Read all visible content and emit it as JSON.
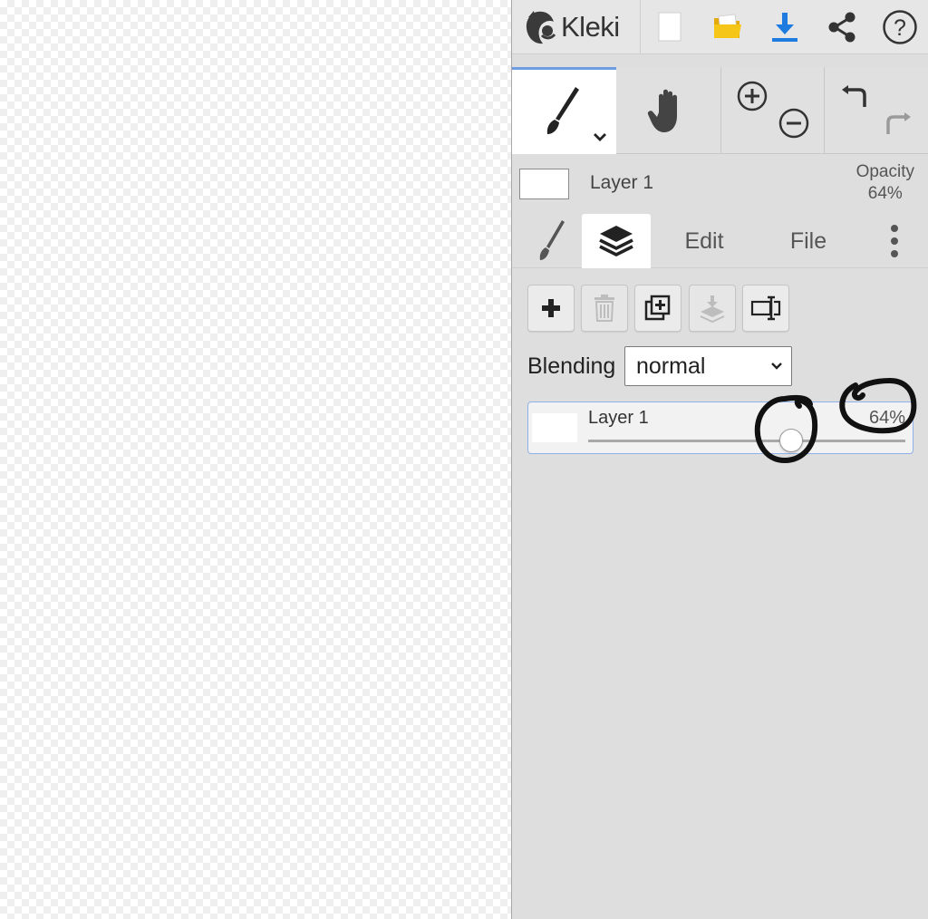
{
  "app": {
    "name": "Kleki"
  },
  "toolbar": {
    "icons": [
      "logo-icon",
      "new-image-icon",
      "open-folder-icon",
      "download-icon",
      "share-icon",
      "help-icon"
    ],
    "help_symbol": "?"
  },
  "tools": {
    "active": "brush",
    "icons": [
      "brush-icon",
      "hand-icon",
      "zoom-in-icon",
      "zoom-out-icon",
      "undo-icon",
      "redo-icon"
    ]
  },
  "layer_info": {
    "layer_name": "Layer 1",
    "opacity_label": "Opacity",
    "opacity_value": "64%"
  },
  "tabs": {
    "edit": "Edit",
    "file": "File",
    "active": "layers"
  },
  "layers_panel": {
    "blending_label": "Blending",
    "blending_value": "normal",
    "layers": [
      {
        "name": "Layer 1",
        "opacity_text": "64%",
        "opacity": 0.64,
        "selected": true
      }
    ]
  },
  "colors": {
    "accent": "#6d9de0",
    "download": "#1e7be0",
    "folder": "#f5c518",
    "selection_border": "#8fb0e8"
  }
}
